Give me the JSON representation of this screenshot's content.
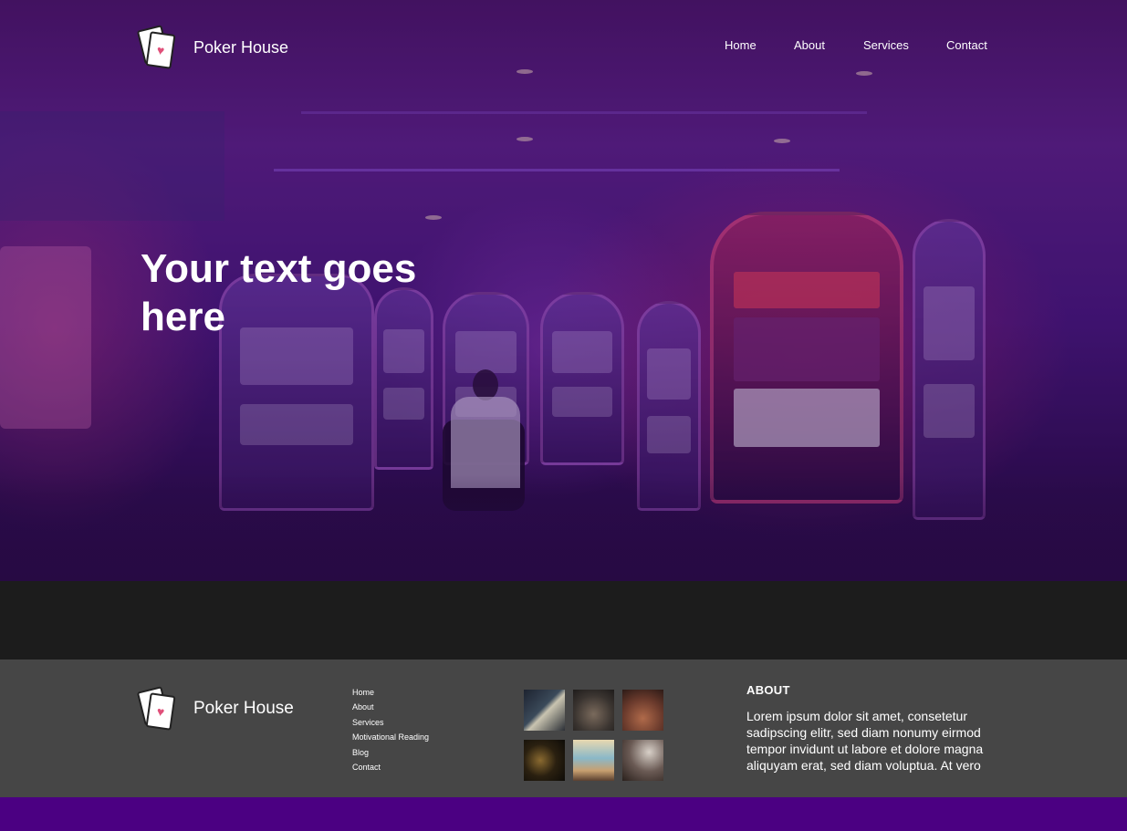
{
  "header": {
    "brand_name": "Poker House",
    "logo_icon": "playing-cards-icon",
    "nav": [
      "Home",
      "About",
      "Services",
      "Contact"
    ]
  },
  "hero": {
    "title": "Your text goes here"
  },
  "footer": {
    "brand_name": "Poker House",
    "links": [
      "Home",
      "About",
      "Services",
      "Motivational Reading",
      "Blog",
      "Contact"
    ],
    "gallery_count": 6,
    "about": {
      "title": "ABOUT",
      "text": "Lorem ipsum dolor sit amet, consetetur sadipscing elitr, sed diam nonumy eirmod tempor invidunt ut labore et dolore magna aliquyam erat, sed diam voluptua. At vero"
    }
  },
  "colors": {
    "accent_purple": "#4b0082",
    "footer_bg": "#464646",
    "band_bg": "#1c1c1c"
  }
}
